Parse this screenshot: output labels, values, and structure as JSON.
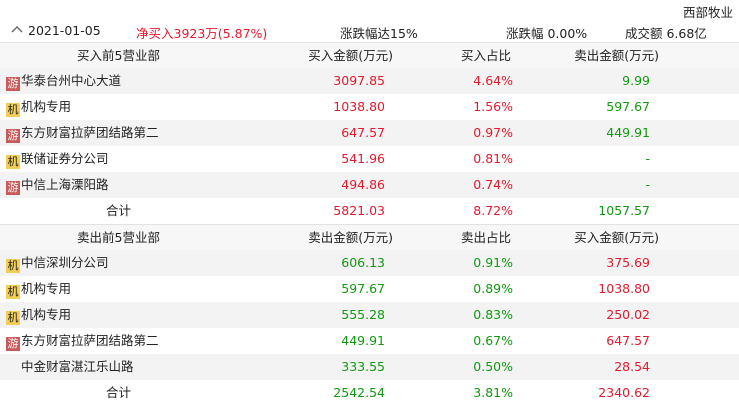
{
  "stock_name": "西部牧业",
  "info": {
    "date": "2021-01-05",
    "net_buy": "净买入3923万(5.87%)",
    "limit": "涨跌幅达15%",
    "change": "涨跌幅 0.00%",
    "turnover": "成交额 6.68亿"
  },
  "badge_labels": {
    "you": "游",
    "ji": "机"
  },
  "buy": {
    "headers": [
      "买入前5营业部",
      "买入金额(万元)",
      "买入占比",
      "卖出金额(万元)"
    ],
    "rows": [
      {
        "type": "you",
        "name": "华泰台州中心大道",
        "a": "3097.85",
        "b": "4.64%",
        "c": "9.99"
      },
      {
        "type": "ji",
        "name": "机构专用",
        "a": "1038.80",
        "b": "1.56%",
        "c": "597.67"
      },
      {
        "type": "you",
        "name": "东方财富拉萨团结路第二",
        "a": "647.57",
        "b": "0.97%",
        "c": "449.91"
      },
      {
        "type": "ji",
        "name": "联储证券分公司",
        "a": "541.96",
        "b": "0.81%",
        "c": "-"
      },
      {
        "type": "you",
        "name": "中信上海溧阳路",
        "a": "494.86",
        "b": "0.74%",
        "c": "-"
      }
    ],
    "total": {
      "label": "合计",
      "a": "5821.03",
      "b": "8.72%",
      "c": "1057.57"
    }
  },
  "sell": {
    "headers": [
      "卖出前5营业部",
      "卖出金额(万元)",
      "卖出占比",
      "买入金额(万元)"
    ],
    "rows": [
      {
        "type": "ji",
        "name": "中信深圳分公司",
        "a": "606.13",
        "b": "0.91%",
        "c": "375.69"
      },
      {
        "type": "ji",
        "name": "机构专用",
        "a": "597.67",
        "b": "0.89%",
        "c": "1038.80"
      },
      {
        "type": "ji",
        "name": "机构专用",
        "a": "555.28",
        "b": "0.83%",
        "c": "250.02"
      },
      {
        "type": "you",
        "name": "东方财富拉萨团结路第二",
        "a": "449.91",
        "b": "0.67%",
        "c": "647.57"
      },
      {
        "type": "none",
        "name": "中金财富湛江乐山路",
        "a": "333.55",
        "b": "0.50%",
        "c": "28.54"
      }
    ],
    "total": {
      "label": "合计",
      "a": "2542.54",
      "b": "3.81%",
      "c": "2340.62"
    }
  },
  "colors": {
    "rise": "#e8182c",
    "fall": "#109a10",
    "badge_you": "#c75a5a",
    "badge_ji": "#f3cf55"
  },
  "icons": {
    "collapse": "chevron-up-icon"
  }
}
